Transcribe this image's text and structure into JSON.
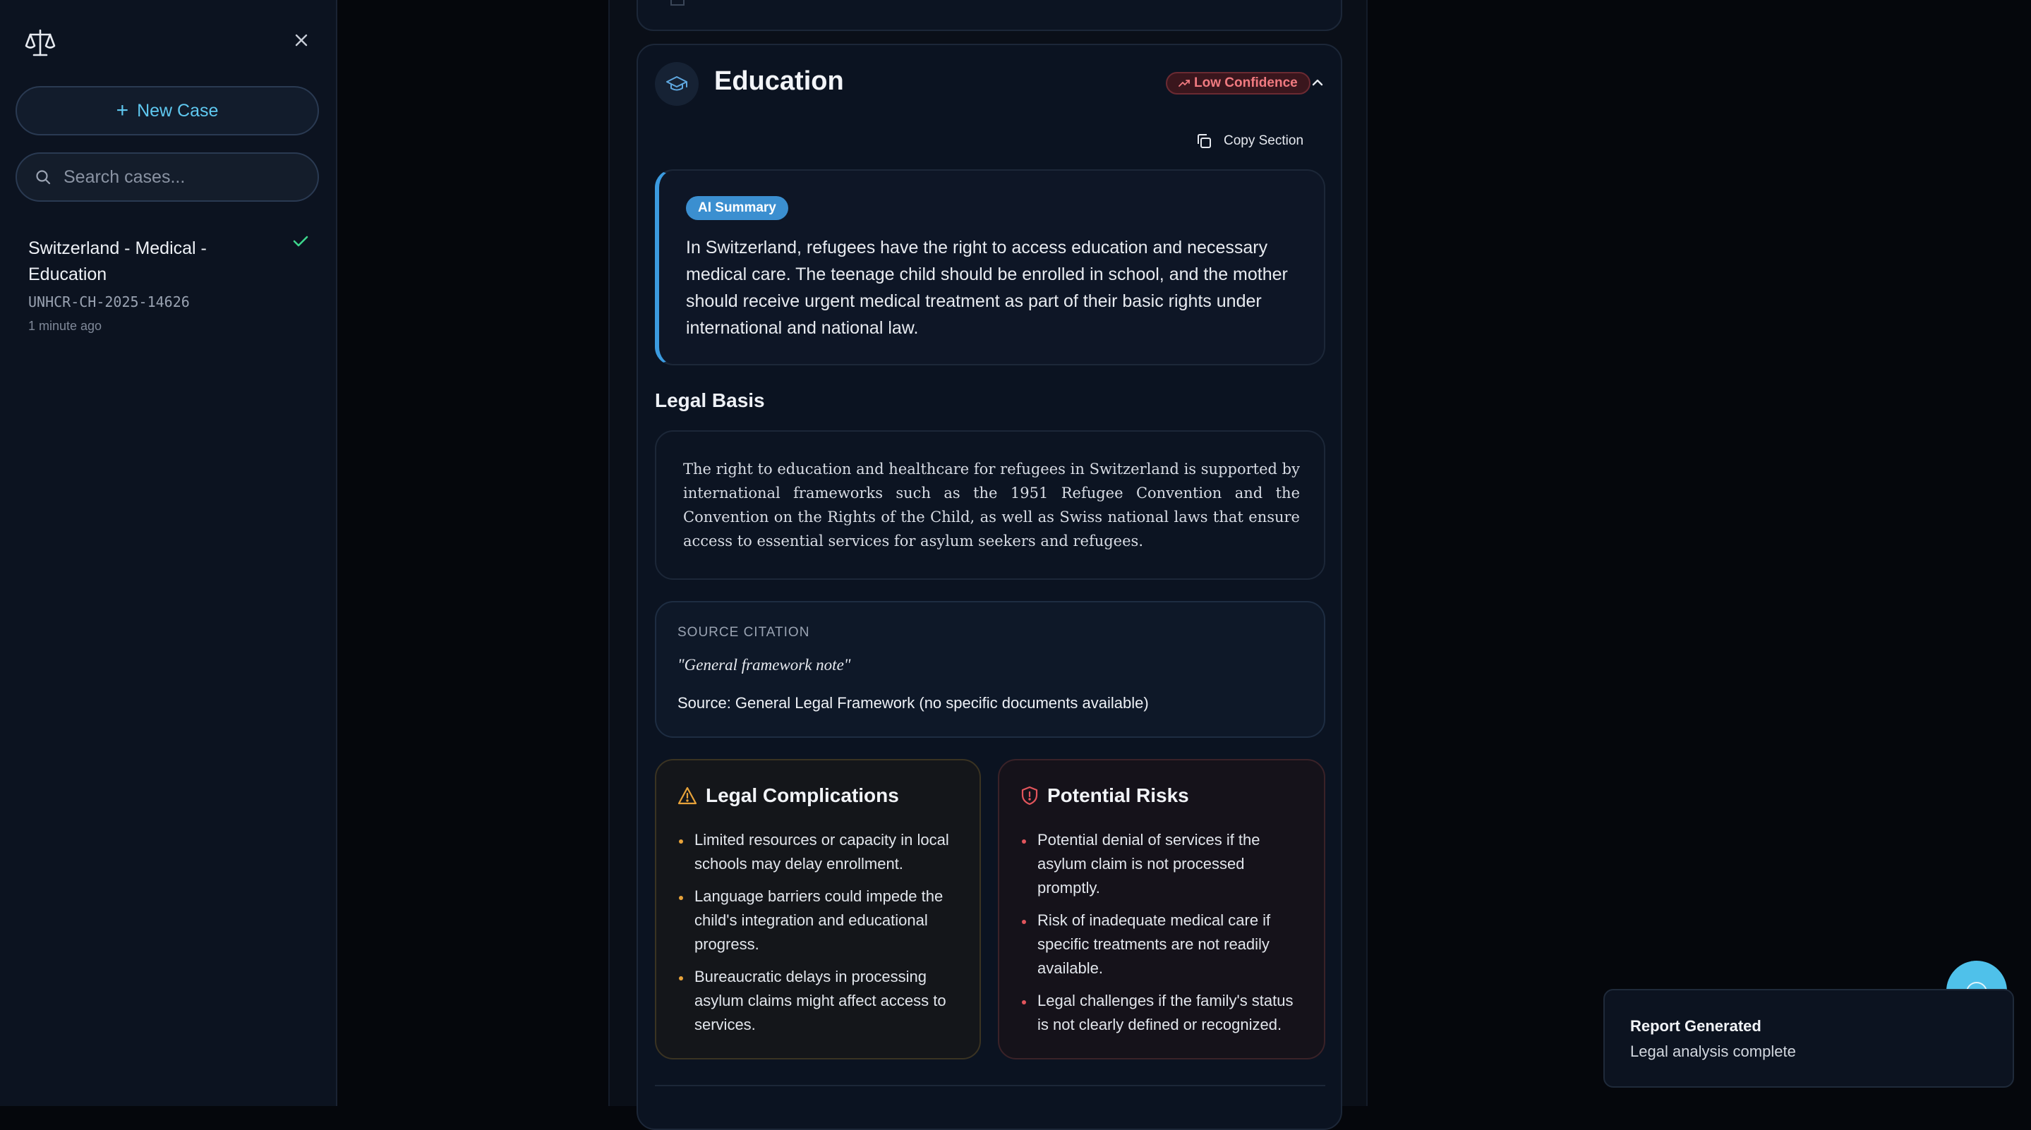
{
  "sidebar": {
    "logo_icon": "scale-icon",
    "close_icon": "close-icon",
    "new_case_label": "New Case",
    "search_placeholder": "Search cases...",
    "cases": [
      {
        "title": "Switzerland - Medical - Education",
        "id": "UNHCR-CH-2025-14626",
        "time": "1 minute ago",
        "status_icon": "check-icon"
      }
    ]
  },
  "section": {
    "icon": "graduation-cap-icon",
    "title": "Education",
    "confidence_label": "Low Confidence",
    "copy_label": "Copy Section",
    "ai_badge": "AI Summary",
    "ai_summary": "In Switzerland, refugees have the right to access education and necessary medical care. The teenage child should be enrolled in school, and the mother should receive urgent medical treatment as part of their basic rights under international and national law.",
    "legal_basis_heading": "Legal Basis",
    "legal_basis_text": "The right to education and healthcare for refugees in Switzerland is supported by international frameworks such as the 1951 Refugee Convention and the Convention on the Rights of the Child, as well as Swiss national laws that ensure access to essential services for asylum seekers and refugees.",
    "citation_label": "SOURCE CITATION",
    "citation_quote": "\"General framework note\"",
    "citation_source": "Source: General Legal Framework (no specific documents available)",
    "complications_heading": "Legal Complications",
    "complications": [
      "Limited resources or capacity in local schools may delay enrollment.",
      "Language barriers could impede the child's integration and educational progress.",
      "Bureaucratic delays in processing asylum claims might affect access to services."
    ],
    "risks_heading": "Potential Risks",
    "risks": [
      "Potential denial of services if the asylum claim is not processed promptly.",
      "Risk of inadequate medical care if specific treatments are not readily available.",
      "Legal challenges if the family's status is not clearly defined or recognized."
    ]
  },
  "toast": {
    "title": "Report Generated",
    "description": "Legal analysis complete"
  },
  "colors": {
    "accent": "#4fc1ea",
    "low_confidence": "#f07a80",
    "warning": "#e8a33a",
    "danger": "#e2555c",
    "success": "#3dd68c"
  }
}
